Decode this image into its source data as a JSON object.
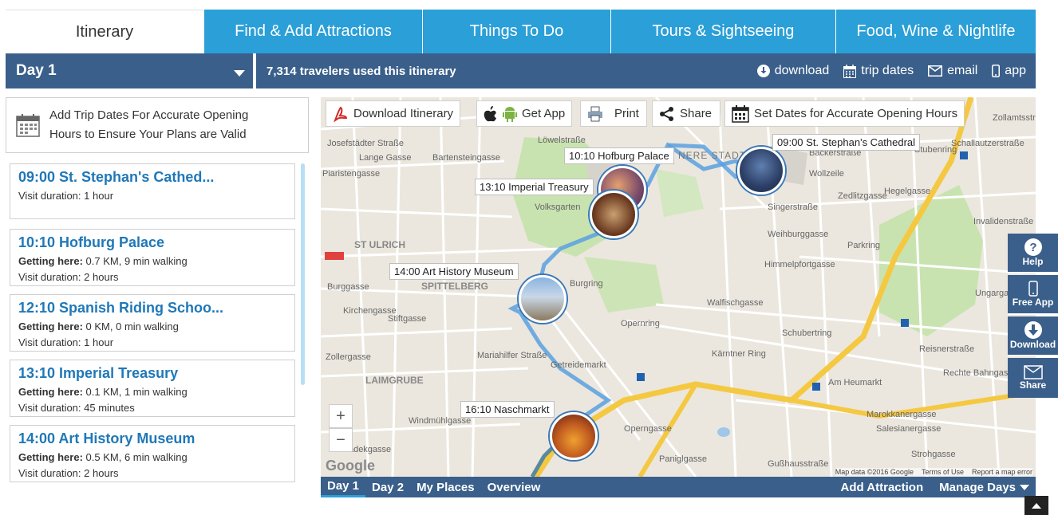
{
  "tabs": [
    {
      "label": "Itinerary"
    },
    {
      "label": "Find & Add Attractions"
    },
    {
      "label": "Things To Do"
    },
    {
      "label": "Tours & Sightseeing"
    },
    {
      "label": "Food, Wine & Nightlife"
    }
  ],
  "day_selector": {
    "label": "Day 1"
  },
  "info_bar": {
    "travelers_text": "7,314 travelers used this itinerary",
    "download": "download",
    "trip_dates": "trip dates",
    "email": "email",
    "app": "app"
  },
  "notice": {
    "line1": "Add Trip Dates For Accurate Opening",
    "line2": "Hours to Ensure Your Plans are Valid"
  },
  "stops": [
    {
      "title": "09:00 St. Stephan's Cathed...",
      "getting_label": "",
      "getting_value": "",
      "visit_label": "Visit duration:",
      "visit_value": "1 hour"
    },
    {
      "title": "10:10 Hofburg Palace",
      "getting_label": "Getting here:",
      "getting_value": "0.7 KM, 9 min walking",
      "visit_label": "Visit duration:",
      "visit_value": "2 hours"
    },
    {
      "title": "12:10 Spanish Riding Schoo...",
      "getting_label": "Getting here:",
      "getting_value": "0 KM, 0 min walking",
      "visit_label": "Visit duration:",
      "visit_value": "1 hour"
    },
    {
      "title": "13:10 Imperial Treasury",
      "getting_label": "Getting here:",
      "getting_value": "0.1 KM, 1 min walking",
      "visit_label": "Visit duration:",
      "visit_value": "45 minutes"
    },
    {
      "title": "14:00 Art History Museum",
      "getting_label": "Getting here:",
      "getting_value": "0.5 KM, 6 min walking",
      "visit_label": "Visit duration:",
      "visit_value": "2 hours"
    }
  ],
  "map_toolbar": {
    "download": "Download Itinerary",
    "get_app": "Get App",
    "print": "Print",
    "share": "Share",
    "set_dates": "Set Dates for Accurate Opening Hours"
  },
  "map_pins": [
    {
      "label": "09:00 St. Stephan's Cathedral"
    },
    {
      "label": "10:10 Hofburg Palace"
    },
    {
      "label": "13:10 Imperial Treasury"
    },
    {
      "label": "14:00 Art History Museum"
    },
    {
      "label": "16:10 Naschmarkt"
    }
  ],
  "map_streets": [
    "Josefstädter Straße",
    "Lange Gasse",
    "Piaristengasse",
    "Bartensteingasse",
    "Löwelstraße",
    "Volksgarten",
    "ST ULRICH",
    "SPITTELBERG",
    "Burggasse",
    "Kirchengasse",
    "Stiftgasse",
    "Mariahilfer Straße",
    "LAIMGRUBE",
    "Getreidemarkt",
    "Windmühlgasse",
    "Schadekgasse",
    "Paniglgasse",
    "Operngasse",
    "Opernring",
    "Kärntner Ring",
    "Schubertring",
    "Walfischgasse",
    "Himmelpfortgasse",
    "Weihburggasse",
    "Singerstraße",
    "Wollzeile",
    "Zedlitzgasse",
    "Parkring",
    "Invalidenstraße",
    "Ungargasse",
    "Reisnerstraße",
    "Am Heumarkt",
    "Strohgasse",
    "Salesianergasse",
    "Rechte Bahngasse",
    "Gußhausstraße",
    "Zollergasse",
    "NERE STADT",
    "Schallautzerstraße",
    "Zollamtsstraße",
    "Bäckerstraße",
    "Stubenring",
    "Hegelgasse",
    "Burgring",
    "Marokkanergasse"
  ],
  "map_attribution": {
    "data": "Map data ©2016 Google",
    "terms": "Terms of Use",
    "report": "Report a map error",
    "logo": "Google"
  },
  "zoom": {
    "plus": "+",
    "minus": "−"
  },
  "map_nav": {
    "day1": "Day 1",
    "day2": "Day 2",
    "my_places": "My Places",
    "overview": "Overview",
    "add_attraction": "Add Attraction",
    "manage_days": "Manage Days"
  },
  "floating": {
    "help": "Help",
    "free_app": "Free App",
    "download": "Download",
    "share": "Share"
  },
  "colors": {
    "tab_blue": "#2a9fd8",
    "bar_navy": "#3a5f8a",
    "title_blue": "#1f78b8",
    "route": "#5aa0e0",
    "major_road": "#f5c842"
  }
}
